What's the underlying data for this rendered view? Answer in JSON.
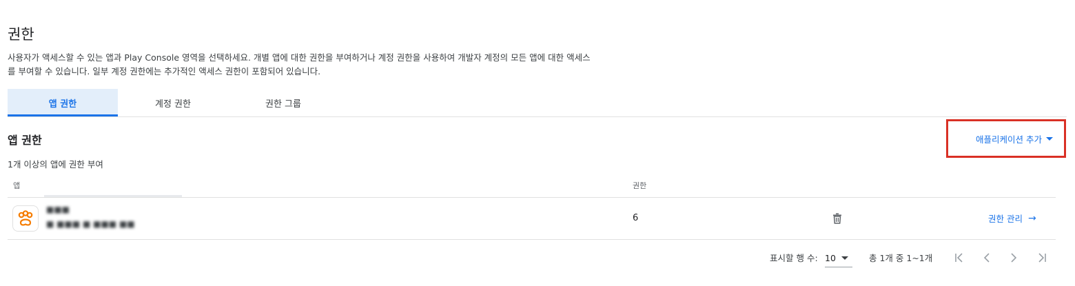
{
  "page": {
    "title": "권한",
    "description_line1": "사용자가 액세스할 수 있는 앱과 Play Console 영역을 선택하세요. 개별 앱에 대한 권한을 부여하거나 계정 권한을 사용하여 개발자 계정의 모든 앱에 대한 액세스",
    "description_line2": "를 부여할 수 있습니다. 일부 계정 권한에는 추가적인 액세스 권한이 포함되어 있습니다."
  },
  "tabs": [
    {
      "label": "앱 권한",
      "active": true
    },
    {
      "label": "계정 권한",
      "active": false
    },
    {
      "label": "권한 그룹",
      "active": false
    }
  ],
  "section": {
    "title": "앱 권한",
    "subtitle": "1개 이상의 앱에 권한 부여",
    "add_app_label": "애플리케이션 추가"
  },
  "table": {
    "columns": [
      "앱",
      "권한"
    ],
    "rows": [
      {
        "permission_count": "6",
        "manage_label": "권한 관리",
        "icon": "paw-icon"
      }
    ]
  },
  "pagination": {
    "rows_per_page_label": "표시할 행 수:",
    "rows_per_page_value": "10",
    "range_label": "총 1개 중 1~1개"
  },
  "colors": {
    "accent": "#1a73e8",
    "highlight_box": "#d93025",
    "app_icon": "#f57c00",
    "active_tab_bg": "#e3eefa"
  }
}
